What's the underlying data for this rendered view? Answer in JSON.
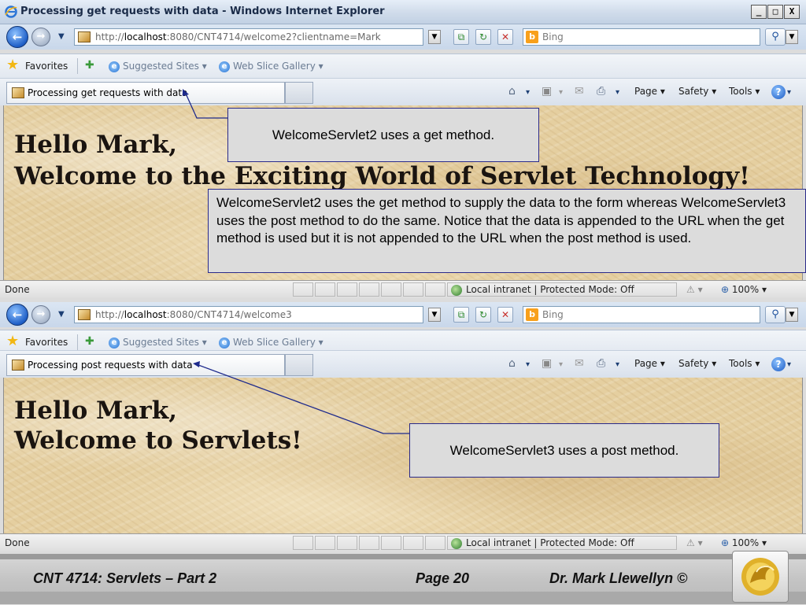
{
  "window": {
    "title": "Processing get requests with data - Windows Internet Explorer",
    "buttons": {
      "minimize": "_",
      "maximize": "□",
      "close": "X"
    }
  },
  "top": {
    "address": {
      "prefix": "http://",
      "host": "localhost",
      "rest": ":8080/CNT4714/welcome2?clientname=Mark"
    },
    "search_placeholder": "Bing",
    "favorites_label": "Favorites",
    "fav_links": [
      "Suggested Sites ▾",
      "Web Slice Gallery ▾"
    ],
    "tab_title": "Processing get requests with data",
    "commands": {
      "page": "Page ▾",
      "safety": "Safety ▾",
      "tools": "Tools ▾"
    },
    "heading_line1": "Hello Mark,",
    "heading_line2": "Welcome to the Exciting World of Servlet Technology!",
    "status_done": "Done",
    "zone": "Local intranet | Protected Mode: Off",
    "zoom": "100%"
  },
  "bottom": {
    "address": {
      "prefix": "http://",
      "host": "localhost",
      "rest": ":8080/CNT4714/welcome3"
    },
    "search_placeholder": "Bing",
    "favorites_label": "Favorites",
    "fav_links": [
      "Suggested Sites ▾",
      "Web Slice Gallery ▾"
    ],
    "tab_title": "Processing post requests with data",
    "commands": {
      "page": "Page ▾",
      "safety": "Safety ▾",
      "tools": "Tools ▾"
    },
    "heading_line1": "Hello Mark,",
    "heading_line2": "Welcome to Servlets!",
    "status_done": "Done",
    "zone": "Local intranet | Protected Mode: Off",
    "zoom": "100%"
  },
  "callouts": {
    "get_method": "WelcomeServlet2 uses a get method.",
    "explanation": "WelcomeServlet2 uses the get method to supply the data to the form whereas WelcomeServlet3 uses the post method to do the same.  Notice that the data is appended to the URL when the get method is used but it is not appended to the URL when the post method is used.",
    "post_method": "WelcomeServlet3 uses a post method."
  },
  "footer": {
    "course": "CNT 4714: Servlets – Part 2",
    "page": "Page 20",
    "author": "Dr. Mark Llewellyn ©"
  },
  "colors": {
    "callout_border": "#2a2a8a",
    "callout_fill": "#dcdcdc",
    "content_parchment": "#e5cfa0",
    "ie_blue": "#1f5fc7"
  },
  "icons": [
    "ie-logo-icon",
    "back-arrow-icon",
    "forward-arrow-icon",
    "refresh-icon",
    "stop-icon",
    "search-icon",
    "favorites-star-icon",
    "add-favorites-icon",
    "home-icon",
    "feeds-icon",
    "mail-icon",
    "print-icon",
    "help-icon",
    "globe-zone-icon",
    "zoom-icon",
    "ucf-pegasus-logo-icon"
  ]
}
